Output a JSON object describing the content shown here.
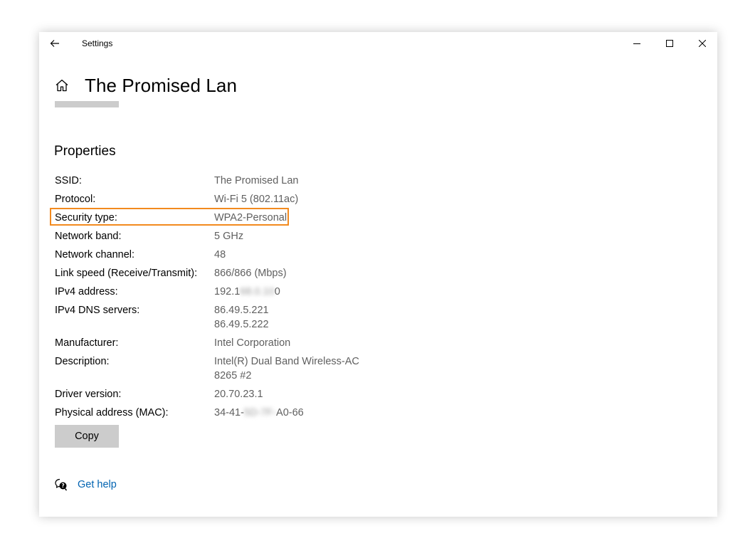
{
  "window": {
    "app_title": "Settings"
  },
  "page": {
    "title": "The Promised Lan"
  },
  "properties": {
    "section_title": "Properties",
    "rows": [
      {
        "label": "SSID:",
        "value": "The Promised Lan"
      },
      {
        "label": "Protocol:",
        "value": "Wi-Fi 5 (802.11ac)"
      },
      {
        "label": "Security type:",
        "value": "WPA2-Personal"
      },
      {
        "label": "Network band:",
        "value": "5 GHz"
      },
      {
        "label": "Network channel:",
        "value": "48"
      },
      {
        "label": "Link speed (Receive/Transmit):",
        "value": "866/866 (Mbps)"
      },
      {
        "label": "IPv4 address:",
        "value_prefix": "192.1",
        "value_redacted": "68.0.10",
        "value_suffix": "0"
      },
      {
        "label": "IPv4 DNS servers:",
        "value_lines": [
          "86.49.5.221",
          "86.49.5.222"
        ]
      },
      {
        "label": "Manufacturer:",
        "value": "Intel Corporation"
      },
      {
        "label": "Description:",
        "value_lines": [
          "Intel(R) Dual Band Wireless-AC",
          "8265 #2"
        ]
      },
      {
        "label": "Driver version:",
        "value": "20.70.23.1"
      },
      {
        "label": "Physical address (MAC):",
        "value_prefix": "34-41-",
        "value_redacted": "5D-7F-",
        "value_suffix": "A0-66"
      }
    ]
  },
  "copy_button": {
    "label": "Copy"
  },
  "help": {
    "label": "Get help"
  },
  "colors": {
    "highlight": "#f28a1e",
    "link": "#0063b1",
    "value_text": "#5f5f5f",
    "button_bg": "#cccccc"
  },
  "icons": {
    "back": "back-arrow-icon",
    "home": "home-icon",
    "minimize": "minimize-icon",
    "maximize": "maximize-icon",
    "close": "close-icon",
    "help": "help-chat-icon"
  }
}
